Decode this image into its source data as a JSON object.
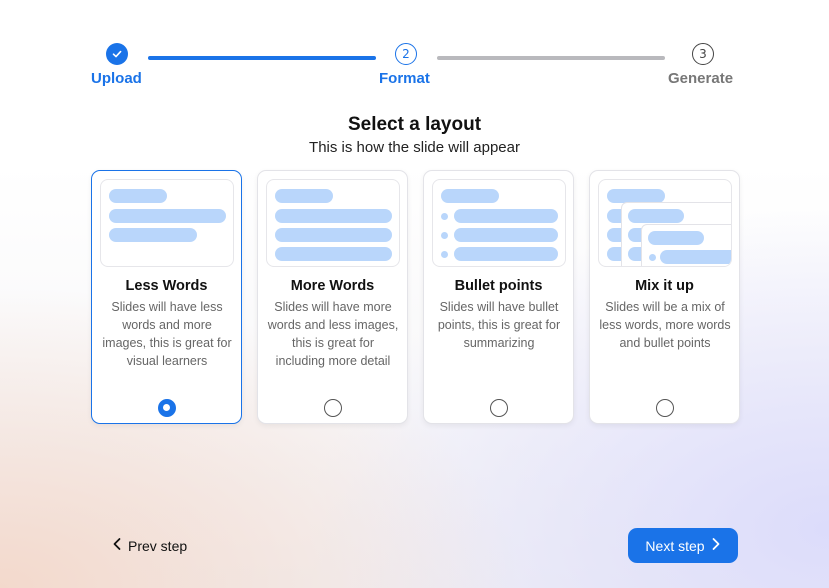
{
  "stepper": {
    "steps": [
      {
        "number": "1",
        "label": "Upload",
        "state": "done",
        "icon": "check-icon"
      },
      {
        "number": "2",
        "label": "Format",
        "state": "active"
      },
      {
        "number": "3",
        "label": "Generate",
        "state": "todo"
      }
    ]
  },
  "main": {
    "title": "Select a layout",
    "subtitle": "This is how the slide will appear"
  },
  "cards": [
    {
      "title": "Less Words",
      "description": "Slides will have less words and more images, this is great for visual learners",
      "selected": true
    },
    {
      "title": "More Words",
      "description": "Slides will have more words and less images, this is great for including more detail",
      "selected": false
    },
    {
      "title": "Bullet points",
      "description": "Slides will have bullet points, this is great for summarizing",
      "selected": false
    },
    {
      "title": "Mix it up",
      "description": "Slides will be a mix of less words, more words and bullet points",
      "selected": false
    }
  ],
  "footer": {
    "prev_label": "Prev step",
    "next_label": "Next step",
    "prev_icon": "chevron-left-icon",
    "next_icon": "chevron-right-icon"
  },
  "colors": {
    "accent": "#1a73e8",
    "placeholder_bar": "#b9d6fb",
    "muted_text": "#666666"
  }
}
